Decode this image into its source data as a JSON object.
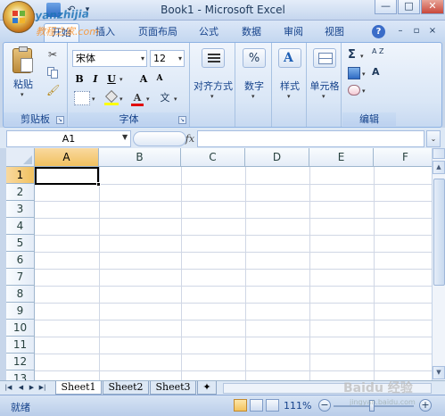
{
  "window": {
    "title": "Book1 - Microsoft Excel",
    "controls": [
      "—",
      "□",
      "✕"
    ]
  },
  "ribbon_tabs": [
    "开始",
    "插入",
    "页面布局",
    "公式",
    "数据",
    "审阅",
    "视图"
  ],
  "ribbon": {
    "clipboard": {
      "paste_label": "粘贴",
      "group_label": "剪贴板"
    },
    "font": {
      "font_name": "宋体",
      "font_size": "12",
      "bold": "B",
      "italic": "I",
      "underline": "U",
      "grow": "A",
      "shrink": "A",
      "font_color": "A",
      "phonetic": "文",
      "group_label": "字体"
    },
    "alignment_label": "对齐方式",
    "number_label": "数字",
    "number_icon": "%",
    "styles_label": "样式",
    "cells_label": "单元格",
    "editing": {
      "sigma": "Σ",
      "sort": "A Z",
      "find": "A",
      "group_label": "编辑"
    }
  },
  "formula_bar": {
    "name_box": "A1",
    "fx": "fx",
    "formula": ""
  },
  "grid": {
    "columns": [
      "A",
      "B",
      "C",
      "D",
      "E",
      "F"
    ],
    "rows": [
      "1",
      "2",
      "3",
      "4",
      "5",
      "6",
      "7",
      "8",
      "9",
      "10",
      "11",
      "12",
      "13"
    ],
    "selected_cell": "A1"
  },
  "sheets": [
    "Sheet1",
    "Sheet2",
    "Sheet3"
  ],
  "active_sheet": "Sheet1",
  "status": {
    "text": "就绪",
    "zoom": "111%"
  },
  "watermarks": {
    "top_left_1": "jingyanzhijia",
    "top_left_2": "教程之家.com",
    "bottom_right_1": "Baidu 经验",
    "bottom_right_2": "jingyan.baidu.com"
  },
  "colors": {
    "accent": "#15428b",
    "ribbon_bg": "#dbe7f7",
    "selected_header": "#f1c15f",
    "grid_line": "#d0d7e5"
  }
}
